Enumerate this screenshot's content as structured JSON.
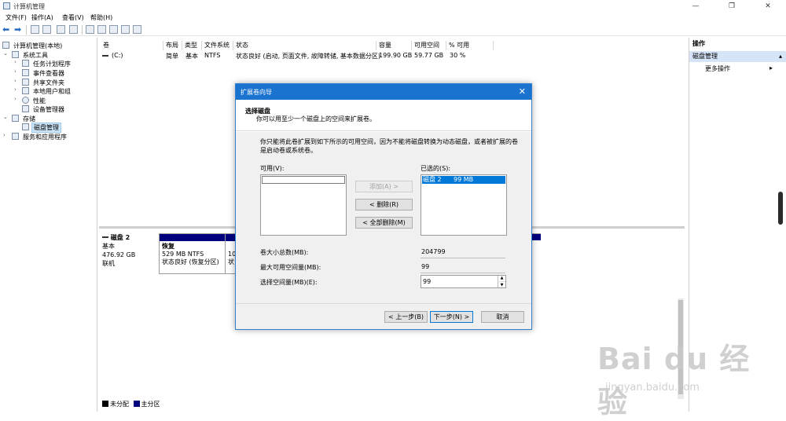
{
  "window": {
    "title": "计算机管理",
    "min": "—",
    "max": "❐",
    "close": "✕"
  },
  "menu": [
    "文件(F)",
    "操作(A)",
    "查看(V)",
    "帮助(H)"
  ],
  "tree": {
    "root": "计算机管理(本地)",
    "system_tools": "系统工具",
    "task_scheduler": "任务计划程序",
    "event_viewer": "事件查看器",
    "shared_folders": "共享文件夹",
    "local_users": "本地用户和组",
    "performance": "性能",
    "device_manager": "设备管理器",
    "storage": "存储",
    "disk_management": "磁盘管理",
    "services_apps": "服务和应用程序"
  },
  "volume_list": {
    "headers": [
      "卷",
      "布局",
      "类型",
      "文件系统",
      "状态",
      "容量",
      "可用空间",
      "% 可用"
    ],
    "rows": [
      {
        "volume": "(C:)",
        "layout": "简单",
        "type": "基本",
        "fs": "NTFS",
        "status": "状态良好 (启动, 页面文件, 故障转储, 基本数据分区)",
        "capacity": "199.90 GB",
        "free": "59.77 GB",
        "pct": "30 %"
      }
    ]
  },
  "disk": {
    "name": "磁盘 2",
    "type": "基本",
    "size": "476.92 GB",
    "status": "联机",
    "partitions": [
      {
        "name": "恢复",
        "size": "529 MB NTFS",
        "status": "状态良好 (恢复分区)"
      },
      {
        "name": "",
        "size": "10",
        "status": "状"
      }
    ]
  },
  "legend": {
    "unallocated": "未分配",
    "primary": "主分区"
  },
  "actions": {
    "header": "操作",
    "section": "磁盘管理",
    "more": "更多操作"
  },
  "dialog": {
    "title": "扩展卷向导",
    "heading": "选择磁盘",
    "subheading": "你可以用至少一个磁盘上的空间来扩展卷。",
    "description": "你只能将此卷扩展到如下所示的可用空间，因为不能将磁盘转换为动态磁盘，或者被扩展的卷是启动卷或系统卷。",
    "available_label": "可用(V):",
    "selected_label": "已选的(S):",
    "selected_items": [
      {
        "disk": "磁盘 2",
        "size": "99 MB"
      }
    ],
    "add_button": "添加(A) >",
    "remove_button": "< 删除(R)",
    "remove_all_button": "< 全部删除(M)",
    "total_label": "卷大小总数(MB):",
    "total_value": "204799",
    "max_label": "最大可用空间量(MB):",
    "max_value": "99",
    "select_label": "选择空间量(MB)(E):",
    "select_value": "99",
    "back_button": "< 上一步(B)",
    "next_button": "下一步(N) >",
    "cancel_button": "取消"
  },
  "watermark": {
    "brand": "Bai du 经验",
    "url": "jingyan.baidu.com"
  }
}
